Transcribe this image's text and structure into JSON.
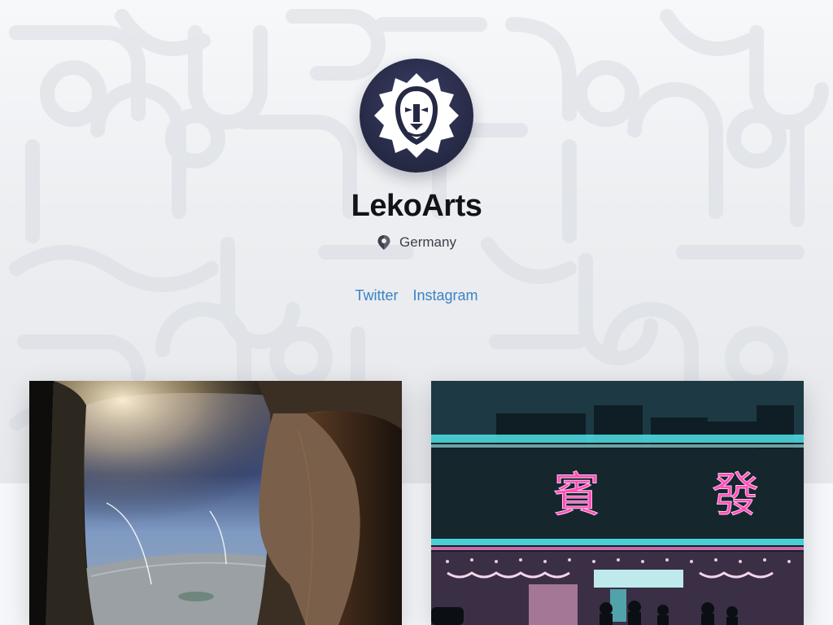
{
  "profile": {
    "name": "LekoArts",
    "location": "Germany",
    "avatar_icon": "lion-logo-icon",
    "location_icon": "map-pin-icon"
  },
  "social": {
    "links": [
      {
        "label": "Twitter"
      },
      {
        "label": "Instagram"
      }
    ]
  },
  "projects": [
    {
      "image": "woman-at-airplane-window",
      "signs": []
    },
    {
      "image": "neon-street-market",
      "signs": [
        "賓",
        "發"
      ]
    }
  ],
  "colors": {
    "link": "#3b82c4",
    "name": "#111318",
    "avatar_bg": "#262944",
    "neon_pink": "#ff4fb8",
    "neon_cyan": "#4fe3e8"
  }
}
